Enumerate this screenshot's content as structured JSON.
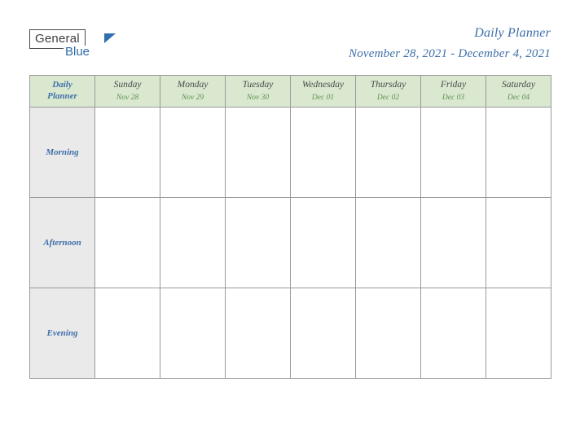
{
  "brand": {
    "word_one": "General",
    "word_two": "Blue",
    "flag_icon": "flag-icon"
  },
  "header": {
    "title": "Daily Planner",
    "date_range": "November 28, 2021 - December 4, 2021"
  },
  "table": {
    "corner_label_line1": "Daily",
    "corner_label_line2": "Planner",
    "days": [
      {
        "name": "Sunday",
        "date": "Nov 28"
      },
      {
        "name": "Monday",
        "date": "Nov 29"
      },
      {
        "name": "Tuesday",
        "date": "Nov 30"
      },
      {
        "name": "Wednesday",
        "date": "Dec 01"
      },
      {
        "name": "Thursday",
        "date": "Dec 02"
      },
      {
        "name": "Friday",
        "date": "Dec 03"
      },
      {
        "name": "Saturday",
        "date": "Dec 04"
      }
    ],
    "rows": [
      {
        "label": "Morning",
        "cells": [
          "",
          "",
          "",
          "",
          "",
          "",
          ""
        ]
      },
      {
        "label": "Afternoon",
        "cells": [
          "",
          "",
          "",
          "",
          "",
          "",
          ""
        ]
      },
      {
        "label": "Evening",
        "cells": [
          "",
          "",
          "",
          "",
          "",
          "",
          ""
        ]
      }
    ]
  },
  "colors": {
    "accent_blue": "#3f6faa",
    "header_green_bg": "#d9e8cf",
    "date_green": "#5f9150",
    "row_label_bg": "#eaeaea",
    "border": "#9a9a9a"
  }
}
